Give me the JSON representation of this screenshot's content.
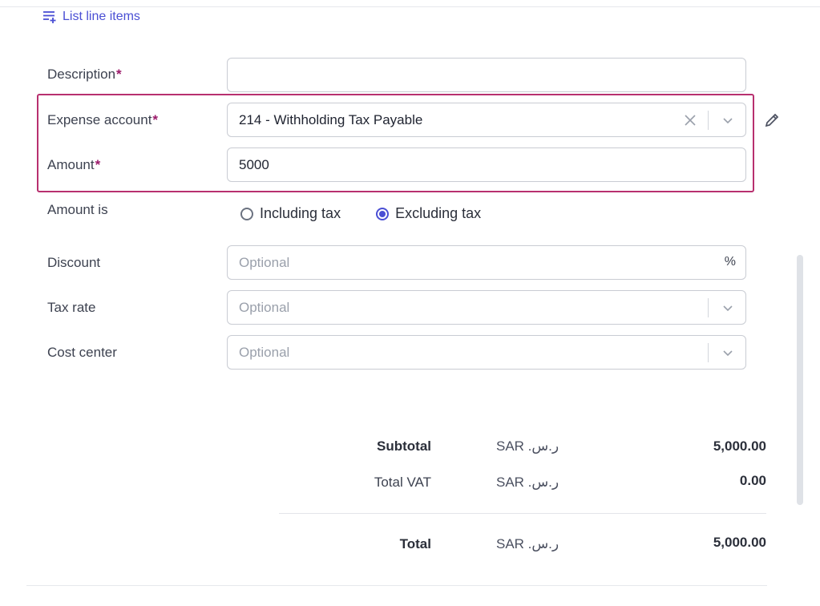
{
  "header": {
    "list_line_items_label": "List line items"
  },
  "form": {
    "description": {
      "label": "Description",
      "required_mark": "*",
      "value": ""
    },
    "expense_account": {
      "label": "Expense account",
      "required_mark": "*",
      "value": "214 - Withholding Tax Payable"
    },
    "amount": {
      "label": "Amount",
      "required_mark": "*",
      "value": "5000"
    },
    "amount_is": {
      "label": "Amount is",
      "options": [
        {
          "label": "Including tax",
          "selected": false
        },
        {
          "label": "Excluding tax",
          "selected": true
        }
      ]
    },
    "discount": {
      "label": "Discount",
      "placeholder": "Optional",
      "suffix": "%"
    },
    "tax_rate": {
      "label": "Tax rate",
      "placeholder": "Optional"
    },
    "cost_center": {
      "label": "Cost center",
      "placeholder": "Optional"
    }
  },
  "totals": {
    "subtotal": {
      "label": "Subtotal",
      "currency": "SAR .ر.س",
      "value": "5,000.00"
    },
    "total_vat": {
      "label": "Total VAT",
      "currency": "SAR .ر.س",
      "value": "0.00"
    },
    "total": {
      "label": "Total",
      "currency": "SAR .ر.س",
      "value": "5,000.00"
    }
  },
  "colors": {
    "accent": "#4a4fd4",
    "highlight_border": "#b8306f",
    "required": "#9b1a6a"
  },
  "icons": {
    "list_add": "list-add-icon",
    "clear": "close-icon",
    "chevron": "chevron-down-icon",
    "edit": "pencil-icon"
  }
}
